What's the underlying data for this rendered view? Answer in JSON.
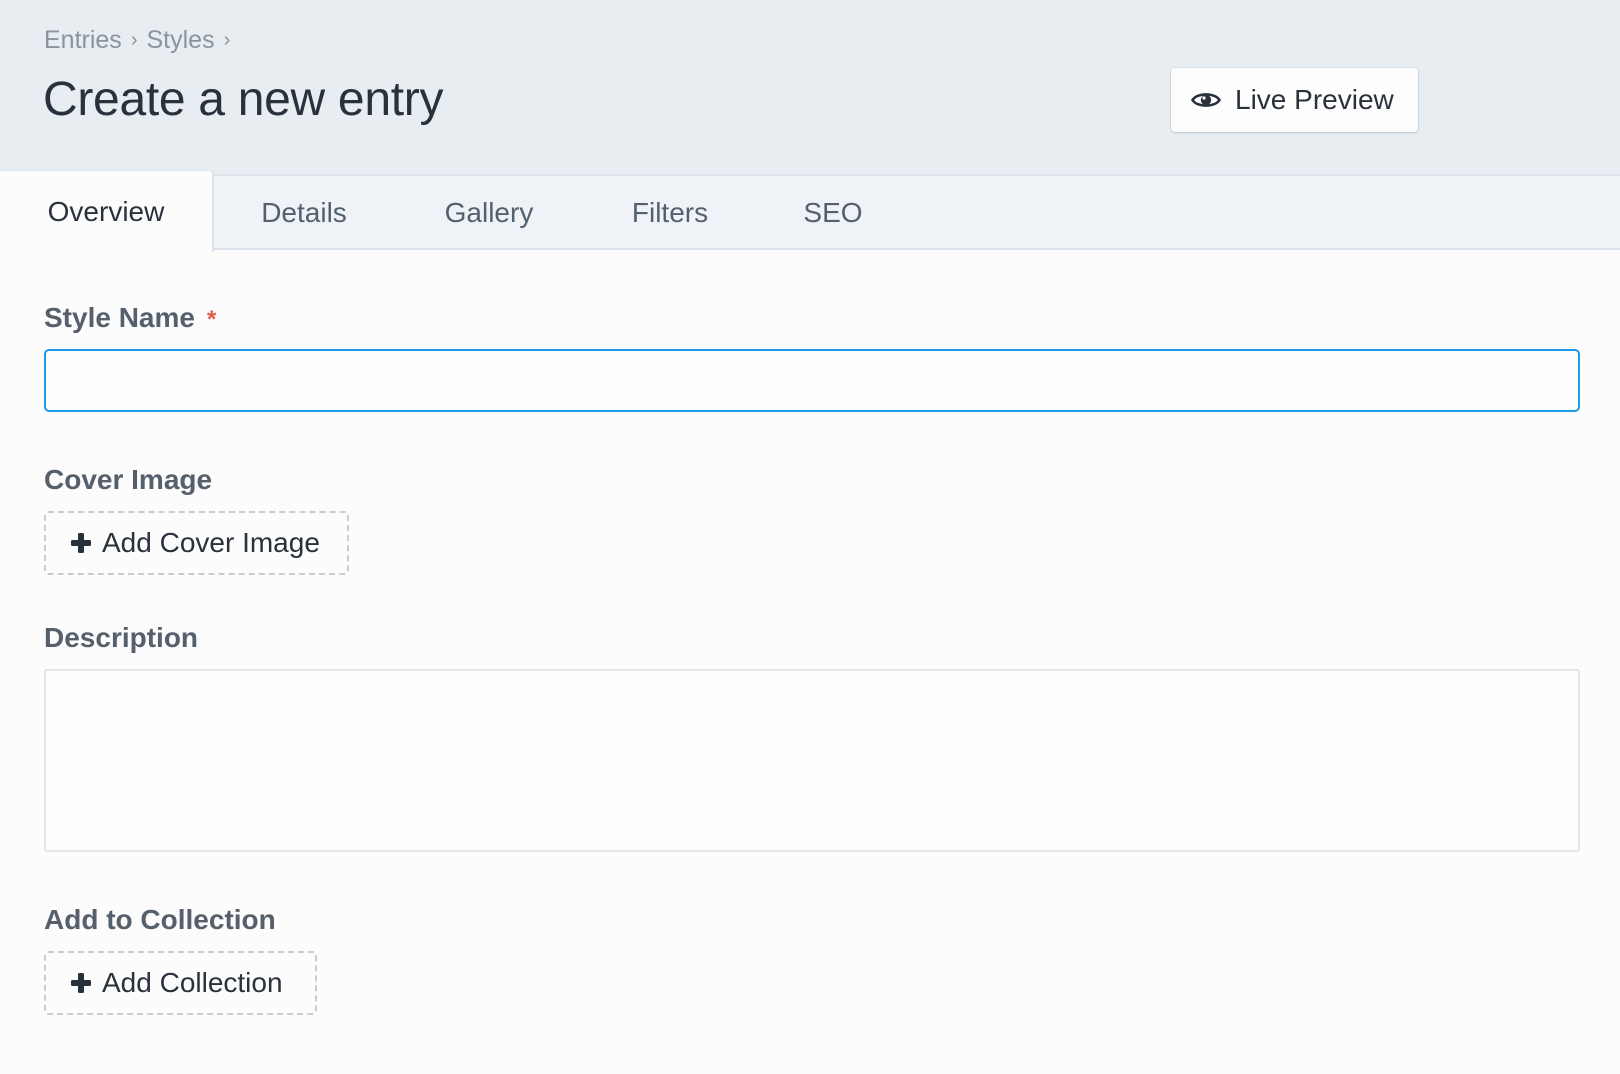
{
  "header": {
    "breadcrumb": [
      "Entries",
      "Styles"
    ],
    "breadcrumb_separator": "›",
    "title": "Create a new entry",
    "live_preview_label": "Live Preview",
    "live_preview_icon": "eye-icon"
  },
  "tabs": [
    {
      "label": "Overview",
      "active": true
    },
    {
      "label": "Details",
      "active": false
    },
    {
      "label": "Gallery",
      "active": false
    },
    {
      "label": "Filters",
      "active": false
    },
    {
      "label": "SEO",
      "active": false
    }
  ],
  "form": {
    "style_name": {
      "label": "Style Name",
      "required_mark": "*",
      "value": "",
      "placeholder": ""
    },
    "cover_image": {
      "label": "Cover Image",
      "button_label": "Add Cover Image",
      "button_icon": "plus-icon"
    },
    "description": {
      "label": "Description",
      "value": "",
      "placeholder": ""
    },
    "collection": {
      "label": "Add to Collection",
      "button_label": "Add Collection",
      "button_icon": "plus-icon"
    }
  },
  "colors": {
    "accent": "#1b9be6",
    "required": "#e05a48",
    "header_bg": "#e8edf2",
    "tabbar_bg": "#eff3f7"
  }
}
